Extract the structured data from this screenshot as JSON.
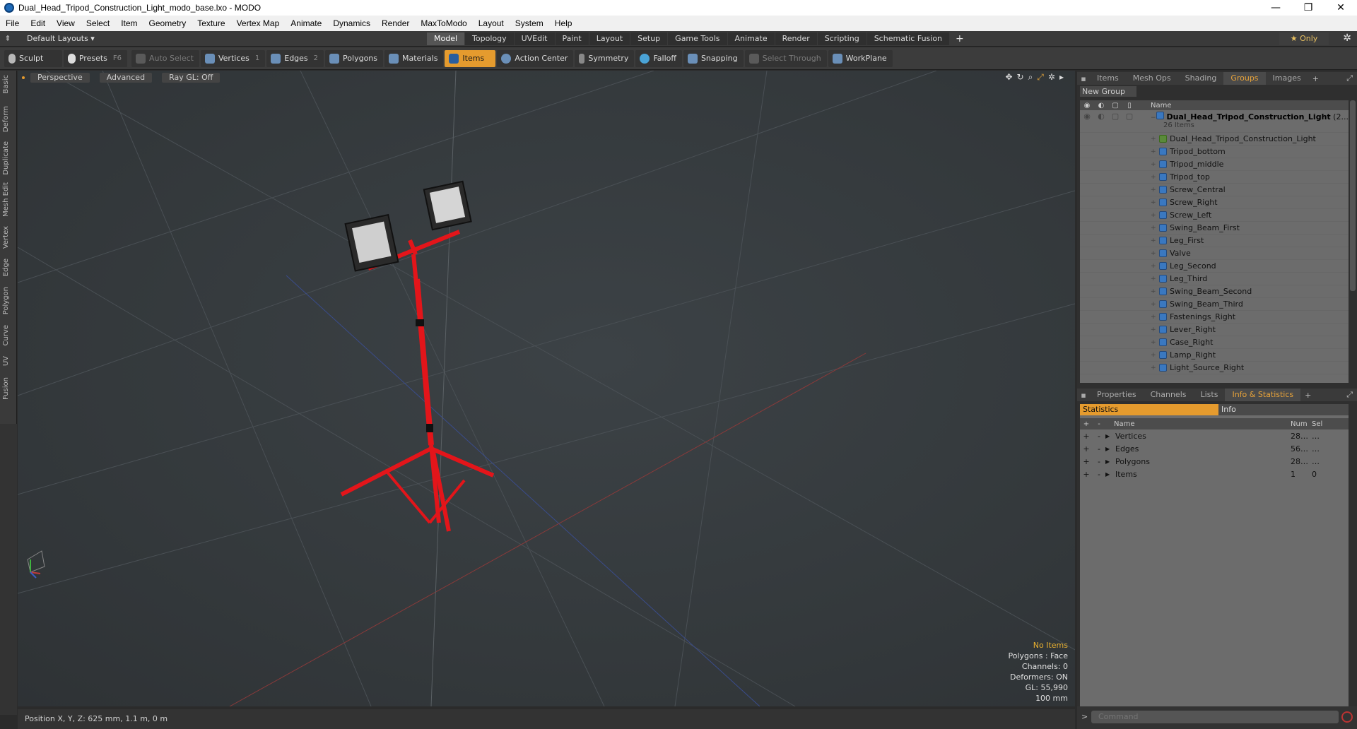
{
  "window": {
    "title": "Dual_Head_Tripod_Construction_Light_modo_base.lxo - MODO",
    "controls": [
      "—",
      "❐",
      "✕"
    ]
  },
  "menu": [
    "File",
    "Edit",
    "View",
    "Select",
    "Item",
    "Geometry",
    "Texture",
    "Vertex Map",
    "Animate",
    "Dynamics",
    "Render",
    "MaxToModo",
    "Layout",
    "System",
    "Help"
  ],
  "layoutbar": {
    "layout_label": "Default Layouts ▾",
    "tabs": [
      "Model",
      "Topology",
      "UVEdit",
      "Paint",
      "Layout",
      "Setup",
      "Game Tools",
      "Animate",
      "Render",
      "Scripting",
      "Schematic Fusion"
    ],
    "active_tab": "Model",
    "add": "+",
    "only_label": "★  Only"
  },
  "toolbar": {
    "sculpt": "Sculpt",
    "presets": "Presets",
    "presets_key": "F6",
    "auto_select": "Auto Select",
    "vertices": "Vertices",
    "vertices_key": "1",
    "edges": "Edges",
    "edges_key": "2",
    "polygons": "Polygons",
    "materials": "Materials",
    "items": "Items",
    "action_center": "Action Center",
    "symmetry": "Symmetry",
    "falloff": "Falloff",
    "snapping": "Snapping",
    "select_through": "Select Through",
    "workplane": "WorkPlane"
  },
  "left_tabs": [
    "Basic",
    "Deform",
    "Duplicate",
    "Mesh Edit",
    "Vertex",
    "Edge",
    "Polygon",
    "Curve",
    "UV",
    "Fusion"
  ],
  "viewport": {
    "view_label": "Perspective",
    "shading_label": "Advanced",
    "raygl_label": "Ray GL: Off",
    "info": {
      "selection": "No Items",
      "polygons": "Polygons : Face",
      "channels": "Channels: 0",
      "deformers": "Deformers: ON",
      "gl": "GL: 55,990",
      "scale": "100 mm"
    }
  },
  "status": {
    "position": "Position X, Y, Z:   625 mm, 1.1 m, 0 m"
  },
  "right_panel": {
    "top_tabs": [
      "Items",
      "Mesh Ops",
      "Shading",
      "Groups",
      "Images"
    ],
    "top_active": "Groups",
    "new_group": "New Group",
    "name_header": "Name",
    "root": {
      "name": "Dual_Head_Tripod_Construction_Light",
      "suffix": "(2...",
      "count": "26 Items"
    },
    "items": [
      "Dual_Head_Tripod_Construction_Light",
      "Tripod_bottom",
      "Tripod_middle",
      "Tripod_top",
      "Screw_Central",
      "Screw_Right",
      "Screw_Left",
      "Swing_Beam_First",
      "Leg_First",
      "Valve",
      "Leg_Second",
      "Leg_Third",
      "Swing_Beam_Second",
      "Swing_Beam_Third",
      "Fastenings_Right",
      "Lever_Right",
      "Case_Right",
      "Lamp_Right",
      "Light_Source_Right"
    ],
    "bottom_tabs": [
      "Properties",
      "Channels",
      "Lists",
      "Info & Statistics"
    ],
    "bottom_active": "Info & Statistics",
    "stats_tab": "Statistics",
    "info_tab": "Info",
    "stats_headers": {
      "name": "Name",
      "num": "Num",
      "sel": "Sel"
    },
    "stats_rows": [
      {
        "name": "Vertices",
        "num": "28…",
        "sel": "…"
      },
      {
        "name": "Edges",
        "num": "56…",
        "sel": "…"
      },
      {
        "name": "Polygons",
        "num": "28…",
        "sel": "…"
      },
      {
        "name": "Items",
        "num": "1",
        "sel": "0"
      }
    ],
    "command_placeholder": "Command"
  }
}
